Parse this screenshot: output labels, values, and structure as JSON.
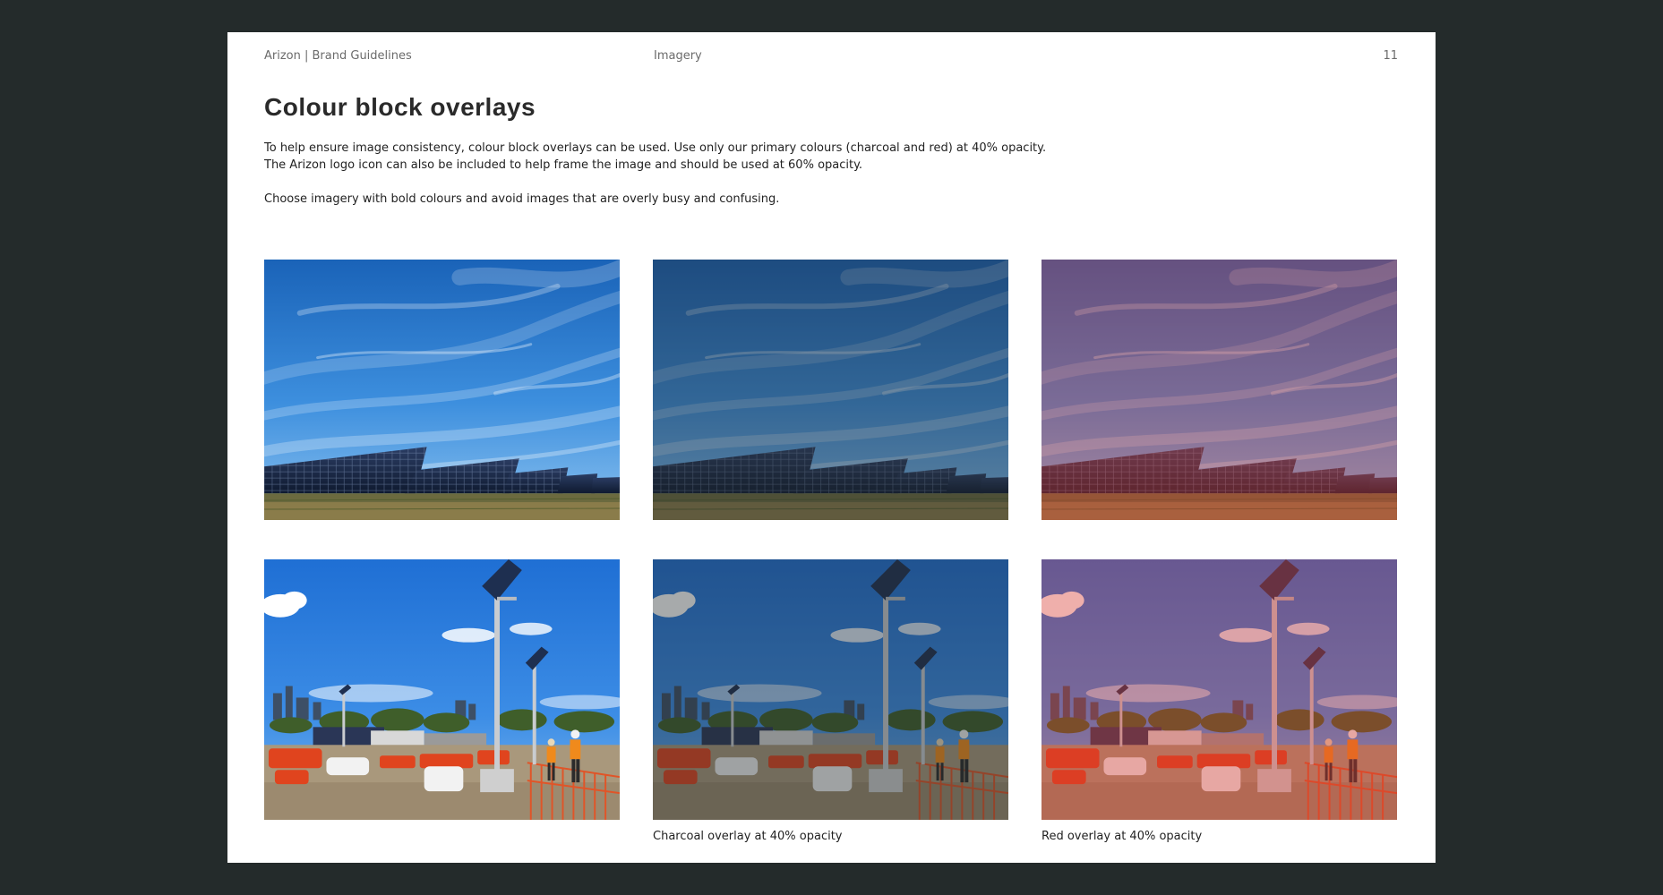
{
  "header": {
    "left": "Arizon | Brand Guidelines",
    "section": "Imagery",
    "page_number": "11"
  },
  "title": "Colour block overlays",
  "body": {
    "line1": "To help ensure image consistency, colour block overlays can be used.  Use only our primary colours (charcoal and red) at 40% opacity.",
    "line2": "The Arizon logo icon can also be included to help frame the image and should be used at 60% opacity.",
    "line3": "Choose imagery with bold colours and avoid images that are overly busy and confusing."
  },
  "captions": {
    "charcoal": "Charcoal overlay at 40% opacity",
    "red": "Red overlay at 40% opacity"
  },
  "overlays": {
    "charcoal": {
      "color": "#232b2e",
      "opacity": 0.4
    },
    "red": {
      "color": "#d6382e",
      "opacity": 0.4
    }
  },
  "images": [
    {
      "subject": "solar-farm-photo",
      "overlay": "none"
    },
    {
      "subject": "solar-farm-photo",
      "overlay": "charcoal"
    },
    {
      "subject": "solar-farm-photo",
      "overlay": "red"
    },
    {
      "subject": "construction-site-photo",
      "overlay": "none"
    },
    {
      "subject": "construction-site-photo",
      "overlay": "charcoal"
    },
    {
      "subject": "construction-site-photo",
      "overlay": "red"
    }
  ]
}
